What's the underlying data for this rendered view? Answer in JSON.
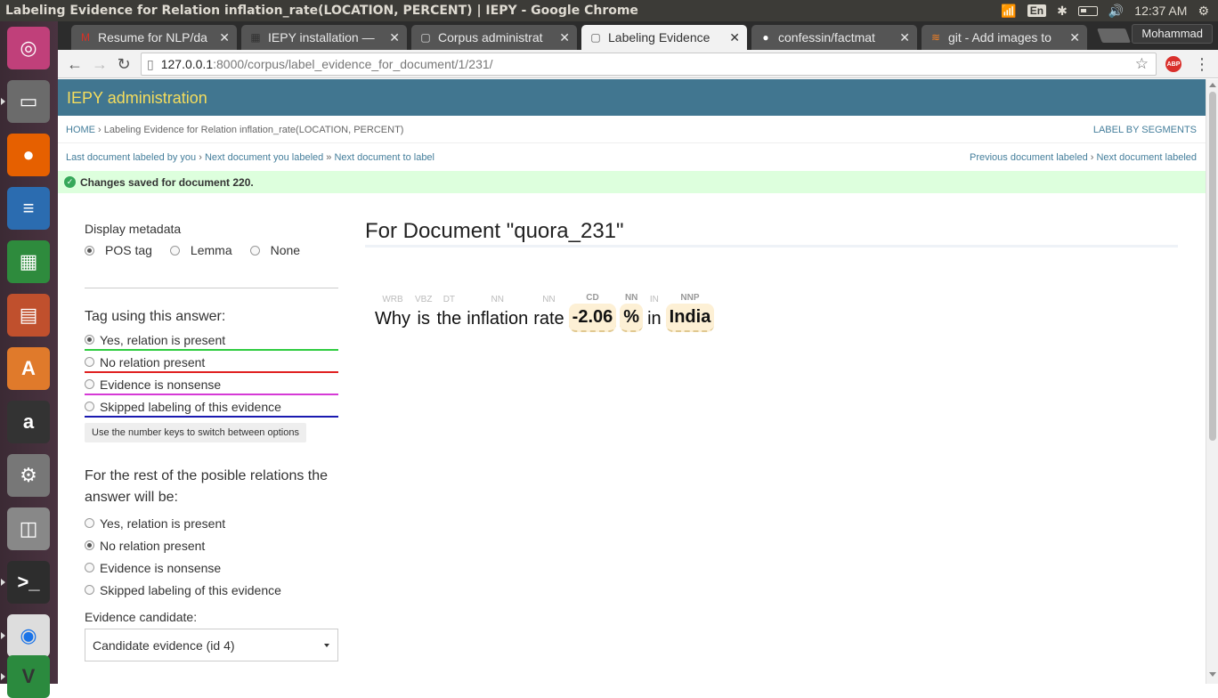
{
  "os": {
    "window_title": "Labeling Evidence for Relation inflation_rate(LOCATION, PERCENT) | IEPY - Google Chrome",
    "lang": "En",
    "clock": "12:37 AM"
  },
  "launcher": [
    {
      "name": "ubuntu-dash-icon",
      "color": "#c0407a",
      "glyph": "◎"
    },
    {
      "name": "files-icon",
      "color": "#6b6b6b",
      "glyph": "▭"
    },
    {
      "name": "firefox-icon",
      "color": "#e66000",
      "glyph": "●"
    },
    {
      "name": "writer-icon",
      "color": "#2b6cb0",
      "glyph": "≡"
    },
    {
      "name": "calc-icon",
      "color": "#2e8b3d",
      "glyph": "▦"
    },
    {
      "name": "impress-icon",
      "color": "#c0502d",
      "glyph": "▤"
    },
    {
      "name": "software-center-icon",
      "color": "#e07a2b",
      "glyph": "A"
    },
    {
      "name": "amazon-icon",
      "color": "#333333",
      "glyph": "a"
    },
    {
      "name": "system-settings-icon",
      "color": "#777777",
      "glyph": "⚙"
    },
    {
      "name": "disk-icon",
      "color": "#888888",
      "glyph": "◫"
    },
    {
      "name": "terminal-icon",
      "color": "#2d2d2d",
      "glyph": ">_"
    },
    {
      "name": "chrome-icon",
      "color": "#dddddd",
      "glyph": "◉"
    },
    {
      "name": "vim-icon",
      "color": "#2b8a3e",
      "glyph": "V"
    }
  ],
  "tabs": [
    {
      "label": "Resume for NLP/da",
      "fav": "M",
      "favcolor": "#d93025"
    },
    {
      "label": "IEPY installation —",
      "fav": "▦",
      "favcolor": "#333"
    },
    {
      "label": "Corpus administrat",
      "fav": "▢",
      "favcolor": "#ddd"
    },
    {
      "label": "Labeling Evidence",
      "fav": "▢",
      "favcolor": "#555"
    },
    {
      "label": "confessin/factmat",
      "fav": "●",
      "favcolor": "#fff"
    },
    {
      "label": "git - Add images to",
      "fav": "≋",
      "favcolor": "#f48024"
    }
  ],
  "profile_name": "Mohammad",
  "url": {
    "host": "127.0.0.1",
    "path": ":8000/corpus/label_evidence_for_document/1/231/"
  },
  "abp": "ABP",
  "admin": {
    "title": "IEPY administration",
    "breadcrumb_home": "HOME",
    "breadcrumb_sep": " › ",
    "breadcrumb_current": "Labeling Evidence for Relation inflation_rate(LOCATION, PERCENT)",
    "label_by_segments": "LABEL BY SEGMENTS",
    "nav": {
      "last_labeled": "Last document labeled by you",
      "sep1": " › ",
      "next_you_labeled": "Next document you labeled",
      "sep2": " » ",
      "next_to_label": "Next document to label",
      "prev_labeled": "Previous document labeled",
      "sep3": " › ",
      "next_labeled": "Next document labeled"
    },
    "message": "Changes saved for document 220."
  },
  "sidebar": {
    "display_metadata": "Display metadata",
    "meta_options": [
      "POS tag",
      "Lemma",
      "None"
    ],
    "tag_heading": "Tag using this answer:",
    "tag_options": [
      {
        "label": "Yes, relation is present",
        "color": "#2ecc40",
        "checked": true
      },
      {
        "label": "No relation present",
        "color": "#e02020",
        "checked": false
      },
      {
        "label": "Evidence is nonsense",
        "color": "#d63ad6",
        "checked": false
      },
      {
        "label": "Skipped labeling of this evidence",
        "color": "#1a1ab0",
        "checked": false
      }
    ],
    "hint": "Use the number keys to switch between options",
    "rest_heading": "For the rest of the posible relations the answer will be:",
    "rest_options": [
      {
        "label": "Yes, relation is present",
        "checked": false
      },
      {
        "label": "No relation present",
        "checked": true
      },
      {
        "label": "Evidence is nonsense",
        "checked": false
      },
      {
        "label": "Skipped labeling of this evidence",
        "checked": false
      }
    ],
    "evidence_label": "Evidence candidate:",
    "evidence_value": "Candidate evidence (id 4)"
  },
  "document": {
    "title": "For Document \"quora_231\"",
    "tokens": [
      {
        "pos": "WRB",
        "word": "Why",
        "entity": false
      },
      {
        "pos": "VBZ",
        "word": "is",
        "entity": false
      },
      {
        "pos": "DT",
        "word": "the",
        "entity": false
      },
      {
        "pos": "NN",
        "word": "inflation",
        "entity": false
      },
      {
        "pos": "NN",
        "word": "rate",
        "entity": false
      },
      {
        "pos": "CD",
        "word": "-2.06",
        "entity": true
      },
      {
        "pos": "NN",
        "word": "%",
        "entity": true
      },
      {
        "pos": "IN",
        "word": "in",
        "entity": false
      },
      {
        "pos": "NNP",
        "word": "India",
        "entity": true
      }
    ]
  }
}
